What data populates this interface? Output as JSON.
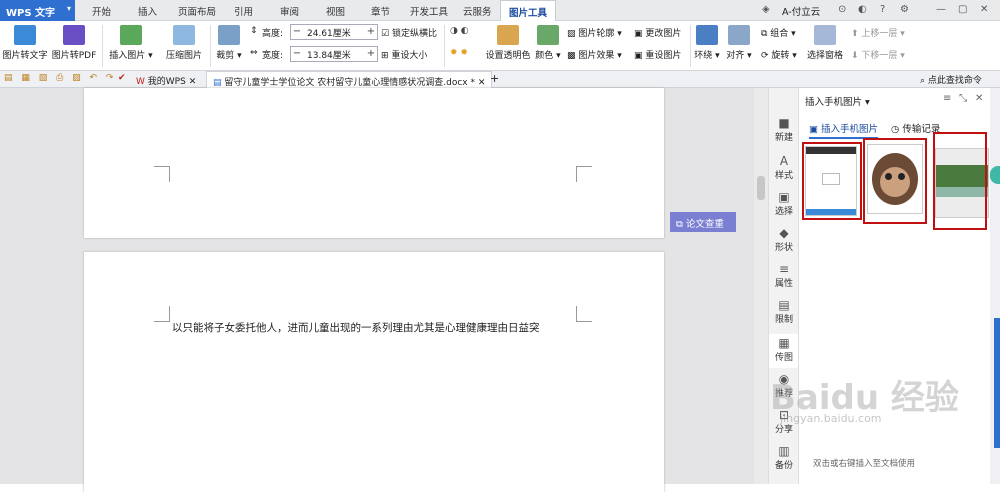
{
  "app": {
    "name": "WPS 文字",
    "dropdown": "▾"
  },
  "menu": [
    "开始",
    "插入",
    "页面布局",
    "引用",
    "审阅",
    "视图",
    "章节",
    "开发工具",
    "云服务",
    "图片工具"
  ],
  "user": {
    "name": "A-付立云"
  },
  "ribbon": {
    "to_text": "图片转文字",
    "to_pdf": "图片转PDF",
    "insert_pic": "插入图片 ▾",
    "compress": "压缩图片",
    "crop": "裁剪 ▾",
    "height_label": "高度:",
    "height_value": "24.61厘米",
    "width_label": "宽度:",
    "width_value": "13.84厘米",
    "minus": "−",
    "plus": "+",
    "lock_ratio": "锁定纵横比",
    "reset_size": "重设大小",
    "transparent": "设置透明色",
    "color": "颜色 ▾",
    "outline": "图片轮廓 ▾",
    "effect": "图片效果 ▾",
    "change_pic": "更改图片",
    "reset_pic": "重设图片",
    "wrap": "环绕 ▾",
    "align": "对齐 ▾",
    "group": "组合 ▾",
    "rotate": "旋转 ▾",
    "select_pane": "选择窗格",
    "bring_forward": "上移一层 ▾",
    "send_backward": "下移一层 ▾"
  },
  "tabs": {
    "my_wps": "我的WPS",
    "doc": "留守儿童学士学位论文 农村留守儿童心理情感状况调查.docx *",
    "new": "+"
  },
  "search_cmd": "点此查找命令",
  "document": {
    "line1": "以只能将子女委托他人，进而儿童出现的一系列理由尤其是心理健康理由日益突"
  },
  "review_btn": "论文查重",
  "sidebar": [
    {
      "icon": "■",
      "label": "新建"
    },
    {
      "icon": "A",
      "label": "样式"
    },
    {
      "icon": "▣",
      "label": "选择"
    },
    {
      "icon": "◆",
      "label": "形状"
    },
    {
      "icon": "≡",
      "label": "属性"
    },
    {
      "icon": "▤",
      "label": "限制"
    },
    {
      "icon": "▦",
      "label": "传图"
    },
    {
      "icon": "◉",
      "label": "推荐"
    },
    {
      "icon": "⊡",
      "label": "分享"
    },
    {
      "icon": "▥",
      "label": "备份"
    }
  ],
  "panel": {
    "title": "插入手机图片 ▾",
    "tab_insert": "插入手机图片",
    "tab_history": "传输记录",
    "hint": "双击或右键插入至文档使用"
  },
  "watermark": {
    "brand": "Baidu 经验",
    "url": "jingyan.baidu.com"
  }
}
